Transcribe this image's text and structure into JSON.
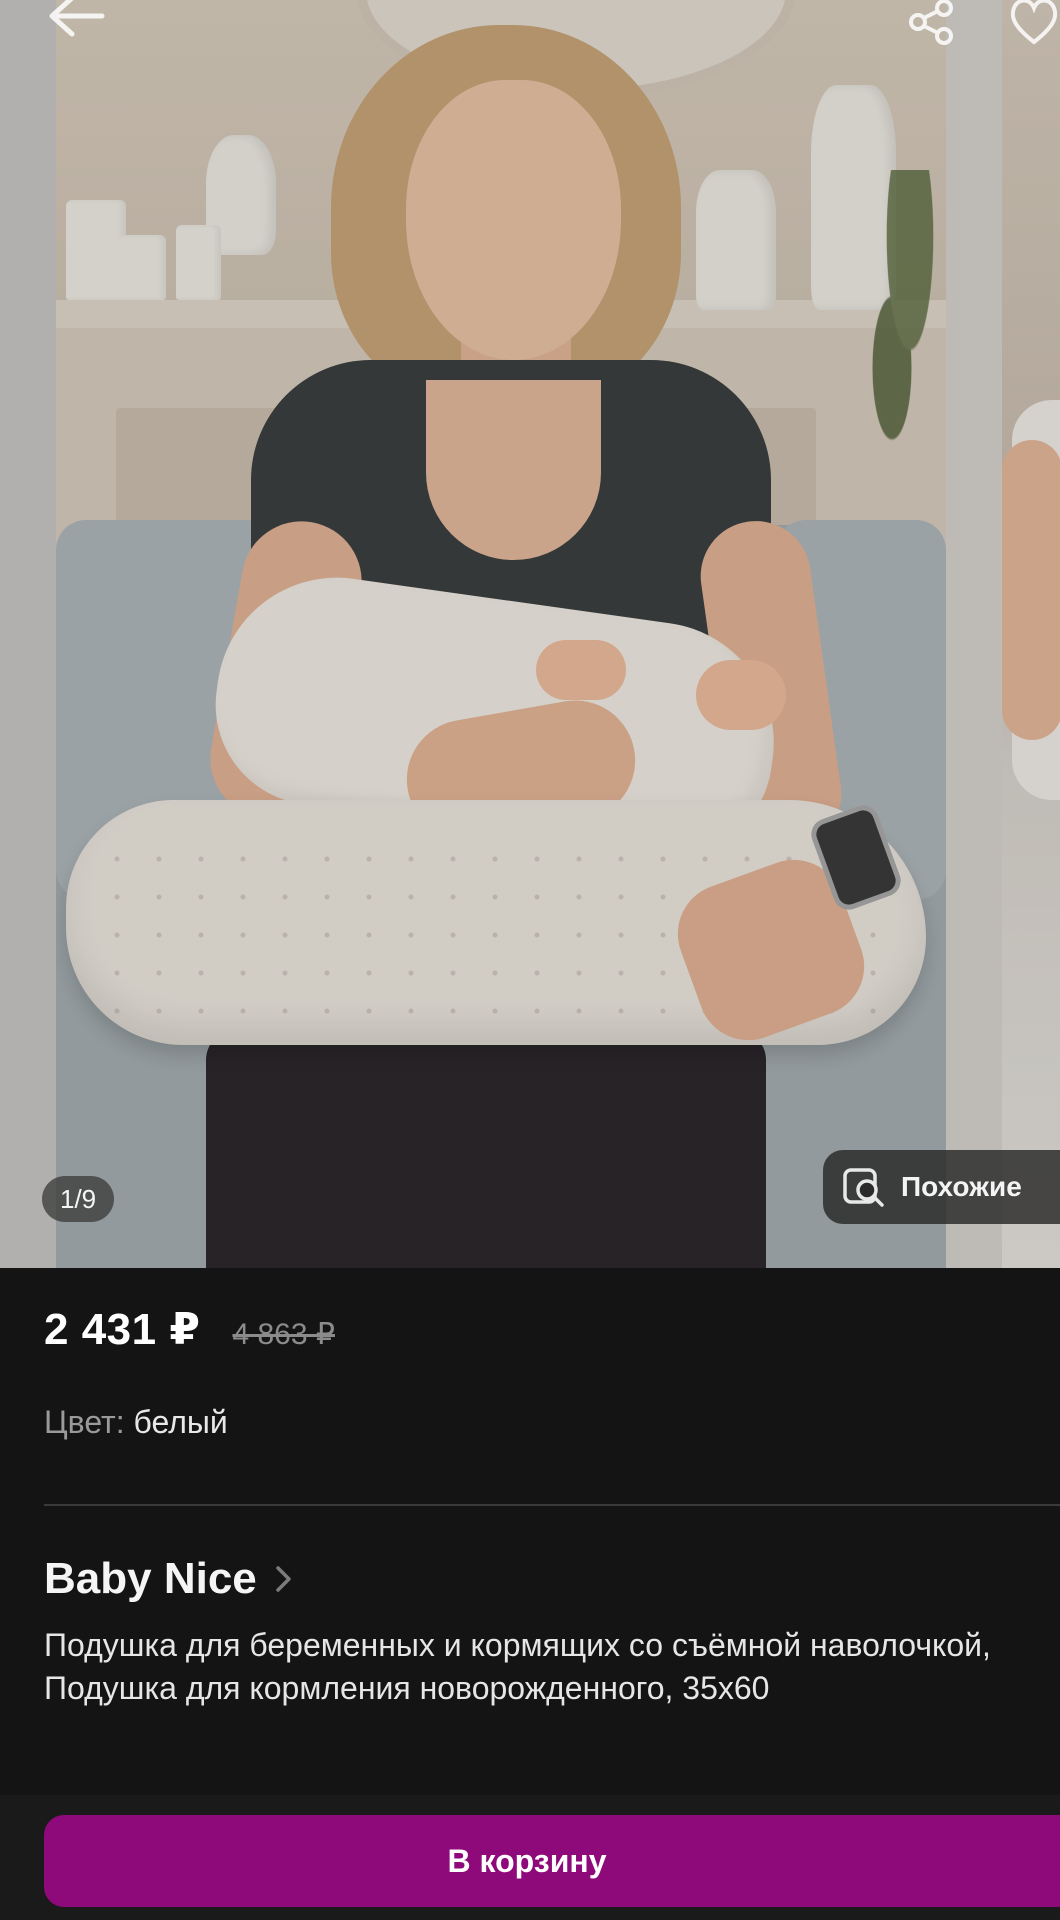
{
  "gallery": {
    "counter": "1/9",
    "similar_label": "Похожие",
    "icons": [
      "back-arrow-icon",
      "share-icon",
      "heart-icon",
      "similar-search-icon"
    ]
  },
  "product": {
    "price": "2 431 ₽",
    "old_price": "4 863 ₽",
    "color_label": "Цвет:",
    "color_value": "белый",
    "brand": "Baby Nice",
    "title": "Подушка для беременных и кормящих со съёмной наволочкой, Подушка для кормления новорожденного, 35х60"
  },
  "actions": {
    "cart_label": "В корзину"
  },
  "colors": {
    "background": "#141414",
    "accent": "#8e0a7a",
    "old_price": "#8b8b8b"
  }
}
